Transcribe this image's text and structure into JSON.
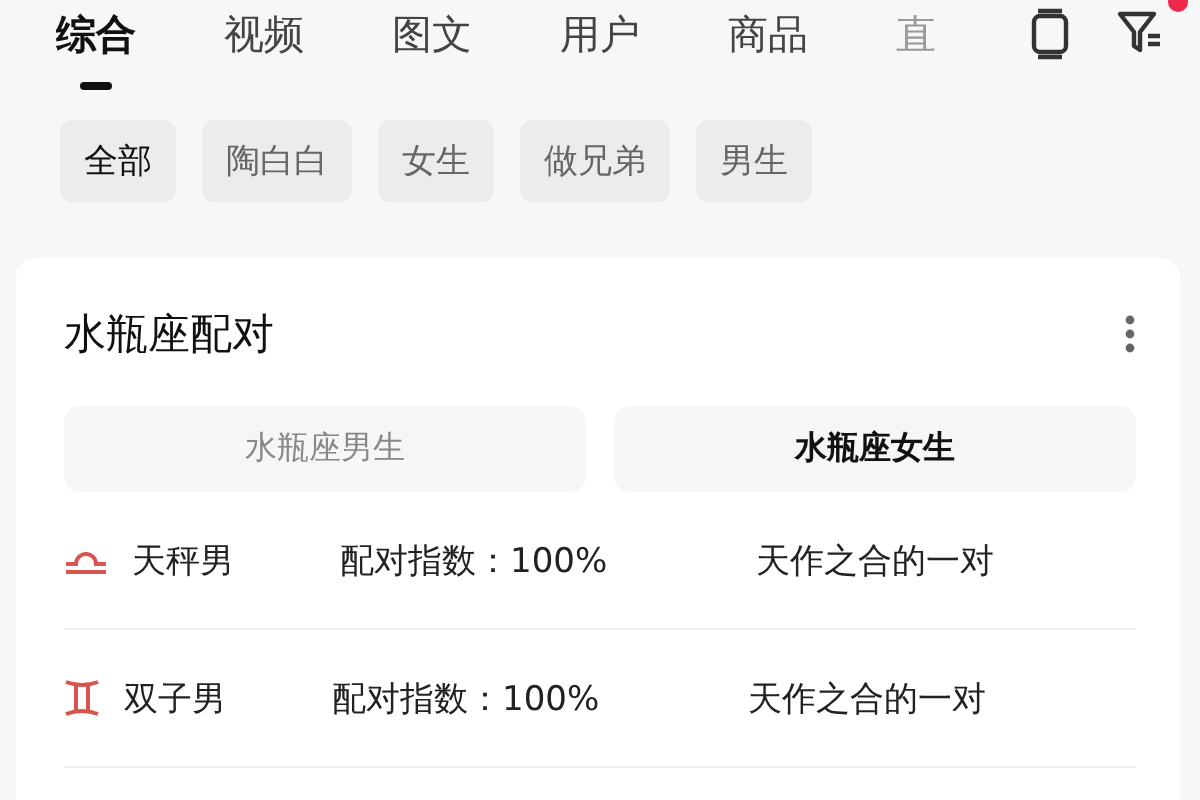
{
  "tabs": [
    {
      "label": "综合",
      "selected": true
    },
    {
      "label": "视频",
      "selected": false
    },
    {
      "label": "图文",
      "selected": false
    },
    {
      "label": "用户",
      "selected": false
    },
    {
      "label": "商品",
      "selected": false
    },
    {
      "label": "直",
      "selected": false,
      "faded": true
    }
  ],
  "filter_badge": true,
  "chips": [
    {
      "label": "全部",
      "selected": true
    },
    {
      "label": "陶白白",
      "selected": false
    },
    {
      "label": "女生",
      "selected": false
    },
    {
      "label": "做兄弟",
      "selected": false
    },
    {
      "label": "男生",
      "selected": false
    }
  ],
  "card": {
    "title": "水瓶座配对",
    "segments": [
      {
        "label": "水瓶座男生",
        "selected": false
      },
      {
        "label": "水瓶座女生",
        "selected": true
      }
    ],
    "rows": [
      {
        "kind": "libra",
        "sign": "天秤男",
        "score": "配对指数：100%",
        "verdict": "天作之合的一对"
      },
      {
        "kind": "gemini",
        "sign": "双子男",
        "score": "配对指数：100%",
        "verdict": "天作之合的一对"
      }
    ]
  }
}
